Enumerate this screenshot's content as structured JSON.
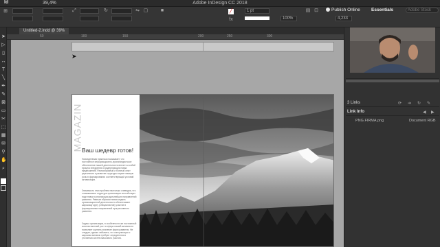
{
  "titlebar": {
    "app_badge": "Id",
    "zoom": "39,4%",
    "title": "Adobe InDesign CC 2018"
  },
  "control": {
    "publish": "Publish Online",
    "essentials": "Essentials",
    "stroke_weight": "1 pt",
    "opacity": "100%",
    "coord_x": "4,233",
    "search_placeholder": "Adobe Stock"
  },
  "tab": {
    "label": "Untitled-2.indd @ 39%"
  },
  "ruler": {
    "ticks": [
      "50",
      "100",
      "150",
      "200",
      "250",
      "300"
    ]
  },
  "document": {
    "magazine": "MAGAZIN",
    "headline": "Ваш шедевр готов!",
    "para1": "Повседневная практика показывает, что постоянное информационно-пропагандистское обеспечение нашей деятельности влечет за собой процесс внедрения и модернизации новых предложений. Разнообразный и богатый опыт укрепление и развитие структуры играет важную роль в формировании соответствующий условий активизации.",
    "para2": "Значимость этих проблем настолько очевидна, что сложившаяся структура организации способствует подготовки и реализации дальнейших направлений развития. Равным образом новая модель организационной деятельности обеспечивает широкому кругу (специалистов) участие в формировании направлений прогрессивного развития.",
    "para3": "Задача организации, в особенности же постоянный количественный рост и сфера нашей активности позволяет оценить значение форм развития. Не следует, однако забывать, что консультация с широким активом требуют определения и уточнения систем массового участия."
  },
  "panel": {
    "file_name": "PNG.FIRMA.png",
    "color_space": "Document RGB",
    "links_count": "3 Links",
    "link_info": "Link Info"
  }
}
